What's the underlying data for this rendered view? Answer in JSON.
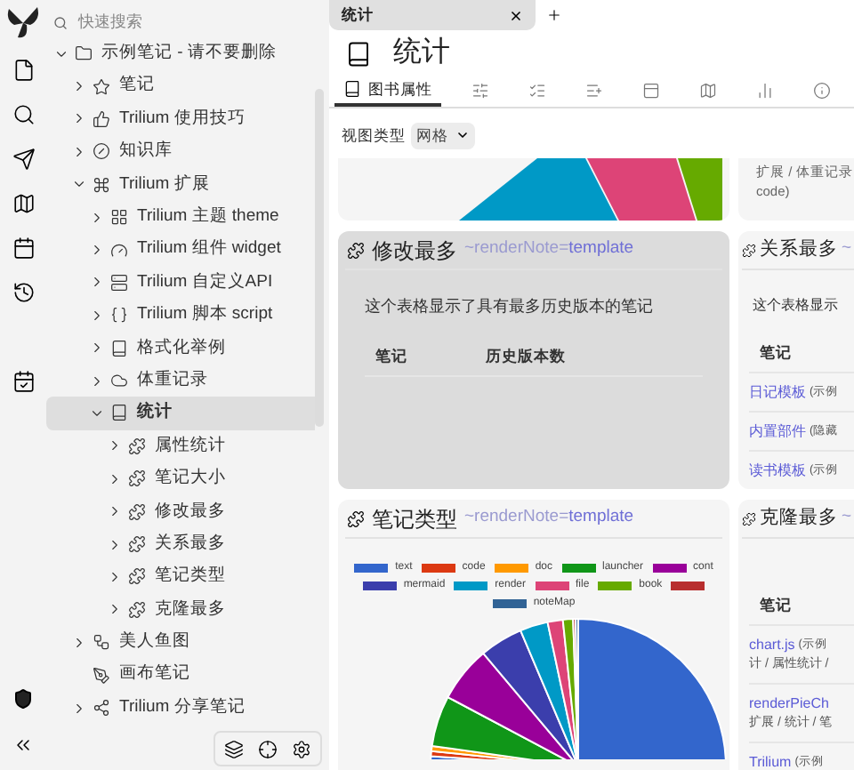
{
  "tree": {
    "search_placeholder": "快速搜索",
    "items": [
      {
        "label": "示例笔记 - 请不要删除",
        "kind": "folder",
        "expanded": true,
        "selected": false,
        "children": [
          {
            "label": "笔记",
            "kind": "star",
            "expanded": false,
            "selected": false
          },
          {
            "label": "Trilium 使用技巧",
            "kind": "thumb",
            "expanded": false,
            "selected": false
          },
          {
            "label": "知识库",
            "kind": "circle",
            "expanded": false,
            "selected": false
          },
          {
            "label": "Trilium 扩展",
            "kind": "command",
            "expanded": true,
            "selected": false,
            "children": [
              {
                "label": "Trilium 主题 theme",
                "kind": "grid",
                "expanded": false,
                "selected": false
              },
              {
                "label": "Trilium 组件 widget",
                "kind": "gauge",
                "expanded": false,
                "selected": false
              },
              {
                "label": "Trilium 自定义API",
                "kind": "server",
                "expanded": false,
                "selected": false
              },
              {
                "label": "Trilium 脚本 script",
                "kind": "braces",
                "expanded": false,
                "selected": false
              },
              {
                "label": "格式化举例",
                "kind": "book",
                "expanded": false,
                "selected": false
              },
              {
                "label": "体重记录",
                "kind": "cloud",
                "expanded": false,
                "selected": false
              },
              {
                "label": "统计",
                "kind": "book",
                "expanded": true,
                "selected": true,
                "children": [
                  {
                    "label": "属性统计",
                    "kind": "puzzle",
                    "expanded": false,
                    "selected": false
                  },
                  {
                    "label": "笔记大小",
                    "kind": "puzzle",
                    "expanded": false,
                    "selected": false
                  },
                  {
                    "label": "修改最多",
                    "kind": "puzzle",
                    "expanded": false,
                    "selected": false
                  },
                  {
                    "label": "关系最多",
                    "kind": "puzzle",
                    "expanded": false,
                    "selected": false
                  },
                  {
                    "label": "笔记类型",
                    "kind": "puzzle",
                    "expanded": false,
                    "selected": false
                  },
                  {
                    "label": "克隆最多",
                    "kind": "puzzle",
                    "expanded": false,
                    "selected": false
                  }
                ]
              }
            ]
          },
          {
            "label": "美人鱼图",
            "kind": "flow",
            "expanded": false,
            "selected": false
          },
          {
            "label": "画布笔记",
            "kind": "pen",
            "selected": false
          },
          {
            "label": "Trilium 分享笔记",
            "kind": "share",
            "expanded": false,
            "selected": false
          }
        ]
      }
    ]
  },
  "tabs": [
    {
      "title": "统计",
      "selected": true
    }
  ],
  "note": {
    "title": "统计"
  },
  "ribbon": [
    {
      "label": "图书属性",
      "kind": "book",
      "selected": true
    },
    {
      "kind": "sliders",
      "selected": false
    },
    {
      "kind": "list-check",
      "selected": false
    },
    {
      "kind": "list-plus",
      "selected": false
    },
    {
      "kind": "panel",
      "selected": false
    },
    {
      "kind": "map",
      "selected": false
    },
    {
      "kind": "chart",
      "selected": false
    },
    {
      "kind": "info",
      "selected": false
    }
  ],
  "view_type": {
    "label": "视图类型",
    "value": "网格"
  },
  "columns": [
    {
      "cards": [
        {
          "kind": "pie_cut",
          "hovered": false
        },
        {
          "kind": "table",
          "hovered": true,
          "title": "修改最多",
          "attribute": "~renderNote=",
          "attribute_value": "template",
          "description": "这个表格显示了具有最多历史版本的笔记",
          "columns": [
            "笔记",
            "历史版本数"
          ]
        },
        {
          "kind": "pie",
          "hovered": false,
          "title": "笔记类型",
          "attribute": "~renderNote=",
          "attribute_value": "template",
          "legend": [
            {
              "label": "text",
              "color": "#3366cc"
            },
            {
              "label": "code",
              "color": "#dc3912"
            },
            {
              "label": "doc",
              "color": "#ff9900"
            },
            {
              "label": "launcher",
              "color": "#109618"
            },
            {
              "label": "cont",
              "color": "#990099"
            },
            {
              "label": "mermaid",
              "color": "#3b3eac"
            },
            {
              "label": "render",
              "color": "#0099c6"
            },
            {
              "label": "file",
              "color": "#dd4477"
            },
            {
              "label": "book",
              "color": "#66aa00"
            },
            {
              "color": "#b82e2e"
            },
            {
              "label": "noteMap",
              "color": "#316395"
            }
          ]
        }
      ]
    },
    {
      "cards": [
        {
          "kind": "list_cut",
          "hovered": false,
          "lines": [
            "扩展 / 体重记录",
            "code)"
          ]
        },
        {
          "kind": "table",
          "hovered": false,
          "title": "关系最多",
          "attribute": "~",
          "description": "这个表格显示",
          "columns": [
            "笔记"
          ],
          "rows": [
            {
              "link": "日记模板",
              "note": "(示例"
            },
            {
              "link": "内置部件",
              "note": "(隐藏"
            },
            {
              "link": "读书模板",
              "note": "(示例"
            }
          ]
        },
        {
          "kind": "table",
          "hovered": false,
          "title": "克隆最多",
          "attribute": "~",
          "columns": [
            "笔记"
          ],
          "rows": [
            {
              "link": "chart.js",
              "note": "(示例",
              "path": "计 / 属性统计 /"
            },
            {
              "link": "renderPieCh",
              "path": "扩展 / 统计 / 笔"
            },
            {
              "link": "Trilium",
              "note": "(示例"
            }
          ]
        }
      ]
    }
  ]
}
